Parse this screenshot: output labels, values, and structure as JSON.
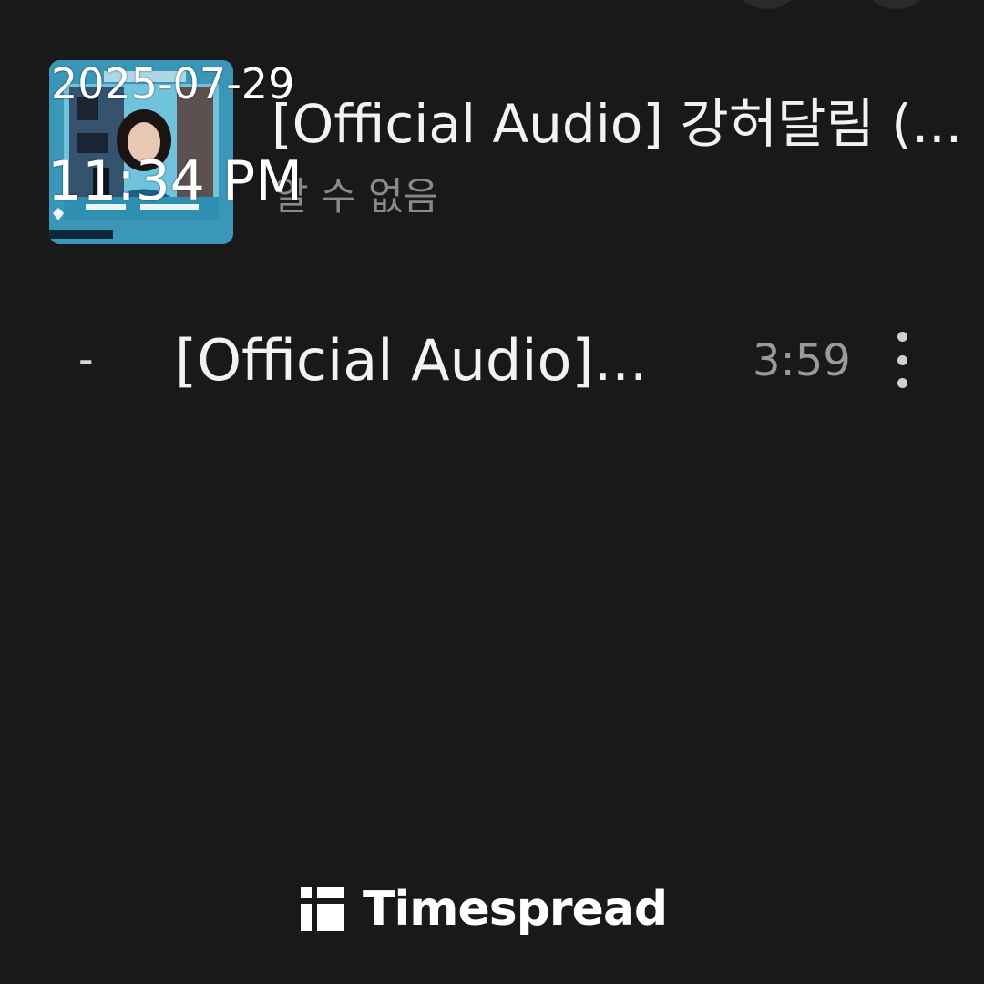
{
  "album": {
    "title": "[Official Audio] 강허달림 (...",
    "artist": "알 수 없음",
    "art_icon": "album-cover-image"
  },
  "tracks": [
    {
      "number": "-",
      "title": "[Official Audio]...",
      "duration": "3:59",
      "menu_icon": "more-vert-icon"
    }
  ],
  "timestamp": {
    "date": "2025-07-29",
    "time": "11:34 PM"
  },
  "watermark": {
    "brand": "Timespread",
    "logo_icon": "timespread-logo-icon"
  },
  "colors": {
    "background": "#191919",
    "primary_text": "#f2f2f2",
    "secondary_text": "#8a8a8a",
    "album_art_accent": "#2f8fb0"
  }
}
